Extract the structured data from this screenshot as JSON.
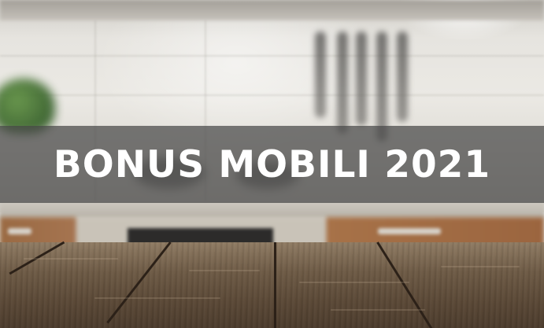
{
  "banner": {
    "title": "BONUS MOBILI 2021"
  },
  "scene": {
    "background": "kitchen-photo",
    "foreground": "wooden-tabletop"
  },
  "colors": {
    "banner_overlay": "#464646",
    "title_text": "#ffffff",
    "wood_dark": "#4c3c2d",
    "wood_light": "#8f7b63"
  }
}
